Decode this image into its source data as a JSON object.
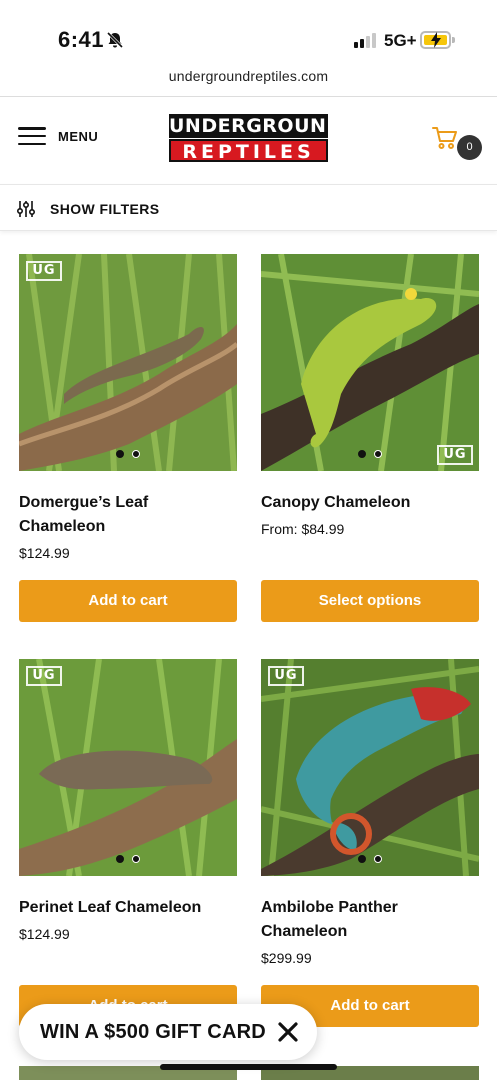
{
  "status_bar": {
    "time": "6:41",
    "network": "5G+"
  },
  "browser": {
    "url": "undergroundreptiles.com"
  },
  "header": {
    "menu_label": "MENU",
    "logo_top": "UNDERGROUND",
    "logo_bottom": "REPTILES",
    "cart_count": "0"
  },
  "filters": {
    "label": "SHOW FILTERS"
  },
  "products": [
    {
      "name": "Domergue’s Leaf Chameleon",
      "price": "$124.99",
      "button": "Add to cart",
      "badge": "UG"
    },
    {
      "name": "Canopy Chameleon",
      "price": "From: $84.99",
      "button": "Select options",
      "badge": "UG"
    },
    {
      "name": "Perinet Leaf Chameleon",
      "price": "$124.99",
      "button": "Add to cart",
      "badge": "UG"
    },
    {
      "name": "Ambilobe Panther Chameleon",
      "price": "$299.99",
      "button": "Add to cart",
      "badge": "UG"
    }
  ],
  "popup": {
    "text": "WIN A $500 GIFT CARD"
  },
  "colors": {
    "accent": "#eb9b19",
    "logo_red": "#d71920",
    "cart_icon": "#eb9b19"
  },
  "icons": {
    "bell": "bell-slash-icon",
    "cart": "cart-icon",
    "filters": "sliders-icon",
    "close": "close-icon"
  }
}
